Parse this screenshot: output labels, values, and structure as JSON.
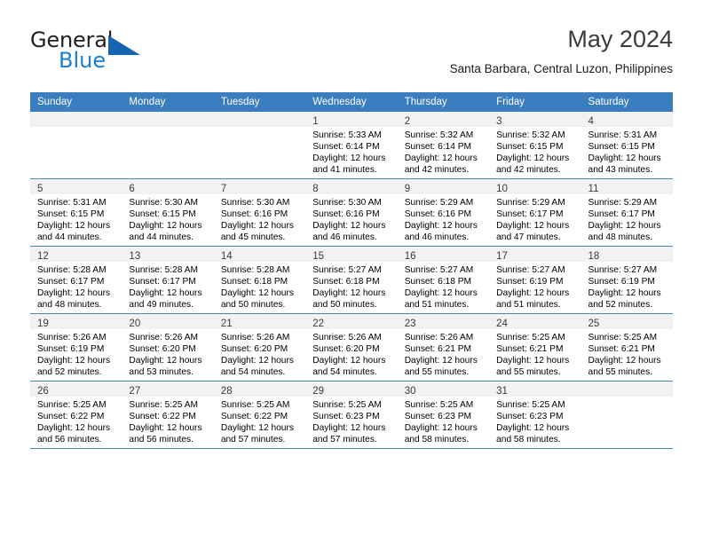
{
  "branding": {
    "logo_primary": "General",
    "logo_secondary": "Blue",
    "logo_shape": "triangle-icon"
  },
  "header": {
    "title": "May 2024",
    "location": "Santa Barbara, Central Luzon, Philippines"
  },
  "colors": {
    "header_bar": "#3a7ebf",
    "row_divider": "#4a86c5",
    "daynum_bg": "#f2f2f2",
    "logo_blue": "#1c7fd1",
    "title_gray": "#3b3b3b"
  },
  "weekdays": [
    "Sunday",
    "Monday",
    "Tuesday",
    "Wednesday",
    "Thursday",
    "Friday",
    "Saturday"
  ],
  "labels": {
    "sunrise_prefix": "Sunrise:",
    "sunset_prefix": "Sunset:",
    "daylight_prefix": "Daylight:"
  },
  "weeks": [
    [
      {
        "day": "",
        "lines": [
          "",
          "",
          "",
          ""
        ],
        "empty": true
      },
      {
        "day": "",
        "lines": [
          "",
          "",
          "",
          ""
        ],
        "empty": true
      },
      {
        "day": "",
        "lines": [
          "",
          "",
          "",
          ""
        ],
        "empty": true
      },
      {
        "day": "1",
        "lines": [
          "Sunrise: 5:33 AM",
          "Sunset: 6:14 PM",
          "Daylight: 12 hours",
          "and 41 minutes."
        ]
      },
      {
        "day": "2",
        "lines": [
          "Sunrise: 5:32 AM",
          "Sunset: 6:14 PM",
          "Daylight: 12 hours",
          "and 42 minutes."
        ]
      },
      {
        "day": "3",
        "lines": [
          "Sunrise: 5:32 AM",
          "Sunset: 6:15 PM",
          "Daylight: 12 hours",
          "and 42 minutes."
        ]
      },
      {
        "day": "4",
        "lines": [
          "Sunrise: 5:31 AM",
          "Sunset: 6:15 PM",
          "Daylight: 12 hours",
          "and 43 minutes."
        ]
      }
    ],
    [
      {
        "day": "5",
        "lines": [
          "Sunrise: 5:31 AM",
          "Sunset: 6:15 PM",
          "Daylight: 12 hours",
          "and 44 minutes."
        ]
      },
      {
        "day": "6",
        "lines": [
          "Sunrise: 5:30 AM",
          "Sunset: 6:15 PM",
          "Daylight: 12 hours",
          "and 44 minutes."
        ]
      },
      {
        "day": "7",
        "lines": [
          "Sunrise: 5:30 AM",
          "Sunset: 6:16 PM",
          "Daylight: 12 hours",
          "and 45 minutes."
        ]
      },
      {
        "day": "8",
        "lines": [
          "Sunrise: 5:30 AM",
          "Sunset: 6:16 PM",
          "Daylight: 12 hours",
          "and 46 minutes."
        ]
      },
      {
        "day": "9",
        "lines": [
          "Sunrise: 5:29 AM",
          "Sunset: 6:16 PM",
          "Daylight: 12 hours",
          "and 46 minutes."
        ]
      },
      {
        "day": "10",
        "lines": [
          "Sunrise: 5:29 AM",
          "Sunset: 6:17 PM",
          "Daylight: 12 hours",
          "and 47 minutes."
        ]
      },
      {
        "day": "11",
        "lines": [
          "Sunrise: 5:29 AM",
          "Sunset: 6:17 PM",
          "Daylight: 12 hours",
          "and 48 minutes."
        ]
      }
    ],
    [
      {
        "day": "12",
        "lines": [
          "Sunrise: 5:28 AM",
          "Sunset: 6:17 PM",
          "Daylight: 12 hours",
          "and 48 minutes."
        ]
      },
      {
        "day": "13",
        "lines": [
          "Sunrise: 5:28 AM",
          "Sunset: 6:17 PM",
          "Daylight: 12 hours",
          "and 49 minutes."
        ]
      },
      {
        "day": "14",
        "lines": [
          "Sunrise: 5:28 AM",
          "Sunset: 6:18 PM",
          "Daylight: 12 hours",
          "and 50 minutes."
        ]
      },
      {
        "day": "15",
        "lines": [
          "Sunrise: 5:27 AM",
          "Sunset: 6:18 PM",
          "Daylight: 12 hours",
          "and 50 minutes."
        ]
      },
      {
        "day": "16",
        "lines": [
          "Sunrise: 5:27 AM",
          "Sunset: 6:18 PM",
          "Daylight: 12 hours",
          "and 51 minutes."
        ]
      },
      {
        "day": "17",
        "lines": [
          "Sunrise: 5:27 AM",
          "Sunset: 6:19 PM",
          "Daylight: 12 hours",
          "and 51 minutes."
        ]
      },
      {
        "day": "18",
        "lines": [
          "Sunrise: 5:27 AM",
          "Sunset: 6:19 PM",
          "Daylight: 12 hours",
          "and 52 minutes."
        ]
      }
    ],
    [
      {
        "day": "19",
        "lines": [
          "Sunrise: 5:26 AM",
          "Sunset: 6:19 PM",
          "Daylight: 12 hours",
          "and 52 minutes."
        ]
      },
      {
        "day": "20",
        "lines": [
          "Sunrise: 5:26 AM",
          "Sunset: 6:20 PM",
          "Daylight: 12 hours",
          "and 53 minutes."
        ]
      },
      {
        "day": "21",
        "lines": [
          "Sunrise: 5:26 AM",
          "Sunset: 6:20 PM",
          "Daylight: 12 hours",
          "and 54 minutes."
        ]
      },
      {
        "day": "22",
        "lines": [
          "Sunrise: 5:26 AM",
          "Sunset: 6:20 PM",
          "Daylight: 12 hours",
          "and 54 minutes."
        ]
      },
      {
        "day": "23",
        "lines": [
          "Sunrise: 5:26 AM",
          "Sunset: 6:21 PM",
          "Daylight: 12 hours",
          "and 55 minutes."
        ]
      },
      {
        "day": "24",
        "lines": [
          "Sunrise: 5:25 AM",
          "Sunset: 6:21 PM",
          "Daylight: 12 hours",
          "and 55 minutes."
        ]
      },
      {
        "day": "25",
        "lines": [
          "Sunrise: 5:25 AM",
          "Sunset: 6:21 PM",
          "Daylight: 12 hours",
          "and 55 minutes."
        ]
      }
    ],
    [
      {
        "day": "26",
        "lines": [
          "Sunrise: 5:25 AM",
          "Sunset: 6:22 PM",
          "Daylight: 12 hours",
          "and 56 minutes."
        ]
      },
      {
        "day": "27",
        "lines": [
          "Sunrise: 5:25 AM",
          "Sunset: 6:22 PM",
          "Daylight: 12 hours",
          "and 56 minutes."
        ]
      },
      {
        "day": "28",
        "lines": [
          "Sunrise: 5:25 AM",
          "Sunset: 6:22 PM",
          "Daylight: 12 hours",
          "and 57 minutes."
        ]
      },
      {
        "day": "29",
        "lines": [
          "Sunrise: 5:25 AM",
          "Sunset: 6:23 PM",
          "Daylight: 12 hours",
          "and 57 minutes."
        ]
      },
      {
        "day": "30",
        "lines": [
          "Sunrise: 5:25 AM",
          "Sunset: 6:23 PM",
          "Daylight: 12 hours",
          "and 58 minutes."
        ]
      },
      {
        "day": "31",
        "lines": [
          "Sunrise: 5:25 AM",
          "Sunset: 6:23 PM",
          "Daylight: 12 hours",
          "and 58 minutes."
        ]
      },
      {
        "day": "",
        "lines": [
          "",
          "",
          "",
          ""
        ],
        "empty": true
      }
    ]
  ]
}
